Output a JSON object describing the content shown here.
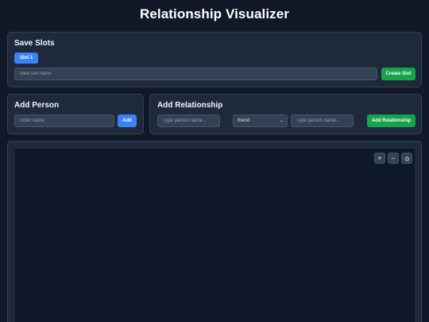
{
  "app": {
    "title": "Relationship Visualizer"
  },
  "save_slots": {
    "title": "Save Slots",
    "slots": [
      {
        "label": "Slot 1",
        "active": true
      }
    ],
    "name_input": {
      "value": "",
      "placeholder": "New slot name"
    },
    "create_label": "Create Slot"
  },
  "add_person": {
    "title": "Add Person",
    "name_input": {
      "value": "",
      "placeholder": "Enter name"
    },
    "add_label": "Add"
  },
  "add_relationship": {
    "title": "Add Relationship",
    "from_input": {
      "value": "",
      "placeholder": "Type person name..."
    },
    "type_select": {
      "selected": "friend"
    },
    "to_input": {
      "value": "",
      "placeholder": "Type person name..."
    },
    "add_label": "Add Relationship"
  },
  "graph": {
    "controls": {
      "zoom_in": "+",
      "zoom_out": "−",
      "reset_icon": "home-icon"
    }
  },
  "colors": {
    "background": "#111827",
    "card": "#1e293b",
    "primary_blue": "#3b82f6",
    "success_green": "#16a34a"
  }
}
